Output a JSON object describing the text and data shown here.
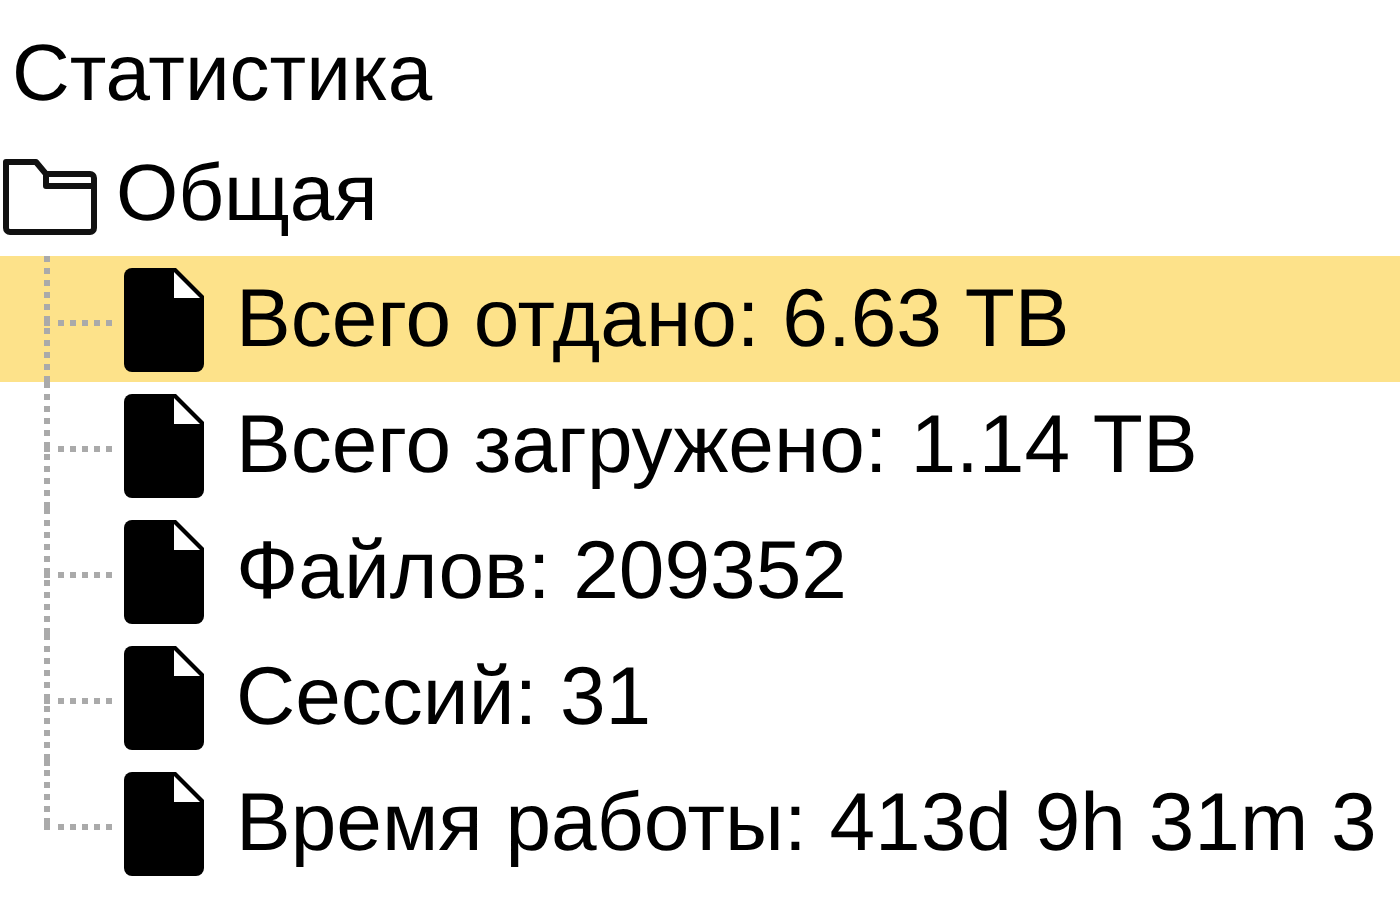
{
  "title": "Статистика",
  "groups": [
    {
      "label": "Общая",
      "children": [
        {
          "label": "Всего отдано: 6.63 TB",
          "selected": true
        },
        {
          "label": "Всего загружено: 1.14 TB",
          "selected": false
        },
        {
          "label": "Файлов: 209352",
          "selected": false
        },
        {
          "label": "Сессий: 31",
          "selected": false
        },
        {
          "label": "Время работы: 413d 9h 31m 3",
          "selected": false
        }
      ]
    }
  ]
}
